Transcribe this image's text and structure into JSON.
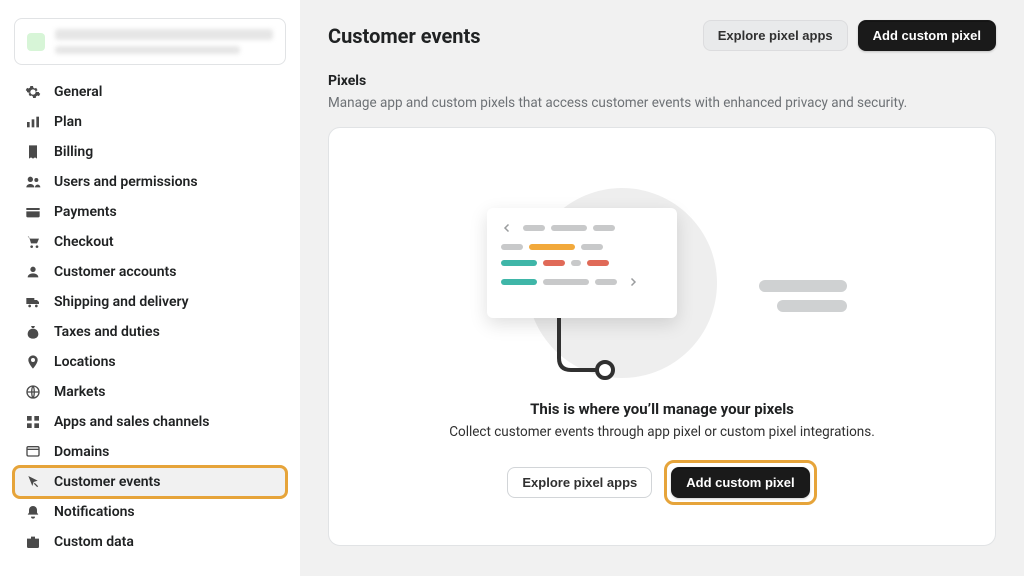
{
  "colors": {
    "highlight": "#e6a43a",
    "primary_button_bg": "#1a1a1a"
  },
  "sidebar": {
    "items": [
      {
        "id": "general",
        "label": "General",
        "icon": "gear-icon",
        "active": false
      },
      {
        "id": "plan",
        "label": "Plan",
        "icon": "chart-icon",
        "active": false
      },
      {
        "id": "billing",
        "label": "Billing",
        "icon": "receipt-icon",
        "active": false
      },
      {
        "id": "users",
        "label": "Users and permissions",
        "icon": "users-icon",
        "active": false
      },
      {
        "id": "payments",
        "label": "Payments",
        "icon": "card-icon",
        "active": false
      },
      {
        "id": "checkout",
        "label": "Checkout",
        "icon": "cart-icon",
        "active": false
      },
      {
        "id": "customer-accounts",
        "label": "Customer accounts",
        "icon": "person-icon",
        "active": false
      },
      {
        "id": "shipping",
        "label": "Shipping and delivery",
        "icon": "truck-icon",
        "active": false
      },
      {
        "id": "taxes",
        "label": "Taxes and duties",
        "icon": "moneybag-icon",
        "active": false
      },
      {
        "id": "locations",
        "label": "Locations",
        "icon": "pin-icon",
        "active": false
      },
      {
        "id": "markets",
        "label": "Markets",
        "icon": "globe-icon",
        "active": false
      },
      {
        "id": "apps",
        "label": "Apps and sales channels",
        "icon": "grid-icon",
        "active": false
      },
      {
        "id": "domains",
        "label": "Domains",
        "icon": "domain-icon",
        "active": false
      },
      {
        "id": "customer-events",
        "label": "Customer events",
        "icon": "cursor-icon",
        "active": true
      },
      {
        "id": "notifications",
        "label": "Notifications",
        "icon": "bell-icon",
        "active": false
      },
      {
        "id": "custom-data",
        "label": "Custom data",
        "icon": "briefcase-icon",
        "active": false
      }
    ]
  },
  "header": {
    "title": "Customer events",
    "explore_label": "Explore pixel apps",
    "add_label": "Add custom pixel"
  },
  "section": {
    "title": "Pixels",
    "subtitle": "Manage app and custom pixels that access customer events with enhanced privacy and security."
  },
  "empty_state": {
    "title": "This is where you’ll manage your pixels",
    "subtitle": "Collect customer events through app pixel or custom pixel integrations.",
    "explore_label": "Explore pixel apps",
    "add_label": "Add custom pixel"
  }
}
